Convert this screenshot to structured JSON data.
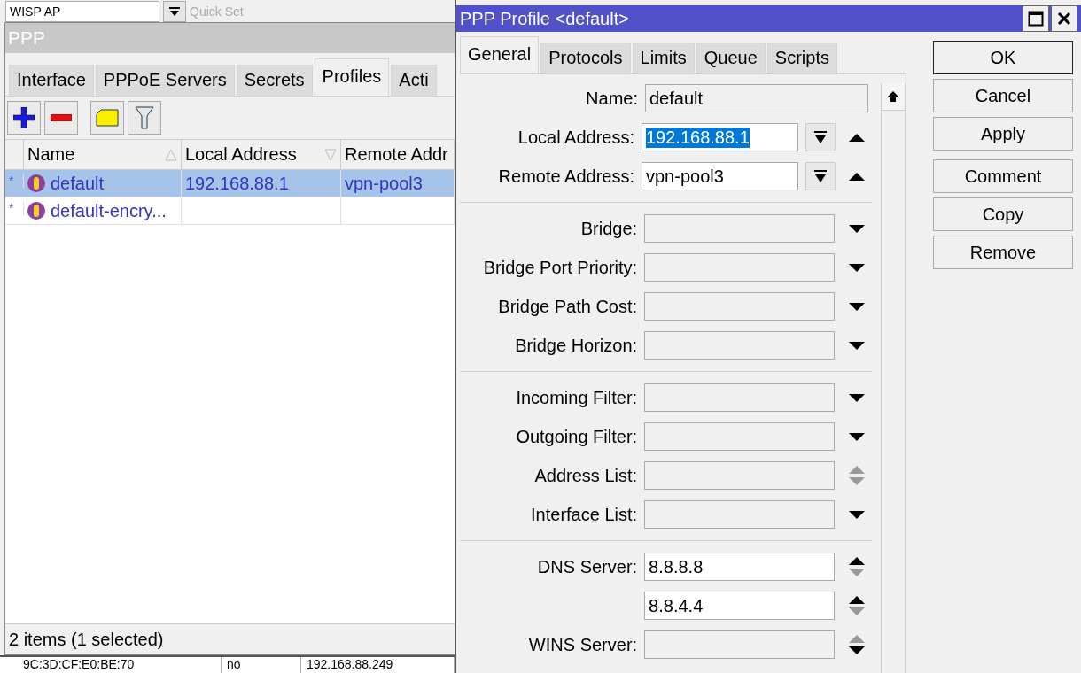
{
  "background": {
    "field_value": "WISP AP",
    "button_label": "Quick Set",
    "row": [
      "9C:3D:CF:E0:BE:70",
      "no",
      "192.168.88.249"
    ]
  },
  "ppp_window": {
    "title": "PPP",
    "tabs": [
      {
        "label": "Interface",
        "selected": false
      },
      {
        "label": "PPPoE Servers",
        "selected": false
      },
      {
        "label": "Secrets",
        "selected": false
      },
      {
        "label": "Profiles",
        "selected": true
      },
      {
        "label": "Acti",
        "selected": false
      }
    ],
    "toolbar": [
      {
        "kind": "add"
      },
      {
        "kind": "remove"
      },
      {
        "kind": "comment"
      },
      {
        "kind": "filter"
      }
    ],
    "table": {
      "columns": [
        {
          "label": "Name",
          "sort_ascending": true
        },
        {
          "label": "Local Address",
          "sort_ascending": false
        },
        {
          "label": "Remote Addr"
        }
      ],
      "rows": [
        {
          "marker": "*",
          "name": "default",
          "local_address": "192.168.88.1",
          "remote_address": "vpn-pool3",
          "selected": true
        },
        {
          "marker": "*",
          "name": "default-encry...",
          "selected": false
        }
      ]
    },
    "status_bar": "2 items (1 selected)"
  },
  "dialog": {
    "title": "PPP Profile <default>",
    "tabs": [
      {
        "label": "General",
        "selected": true
      },
      {
        "label": "Protocols",
        "selected": false
      },
      {
        "label": "Limits",
        "selected": false
      },
      {
        "label": "Queue",
        "selected": false
      },
      {
        "label": "Scripts",
        "selected": false
      }
    ],
    "sections": [
      [
        {
          "kind": "text",
          "label": "Name:",
          "value": "default",
          "editable": false
        },
        {
          "kind": "combo",
          "label": "Local Address:",
          "value": "192.168.88.1",
          "editable": true,
          "highlighted": true
        },
        {
          "kind": "combo",
          "label": "Remote Address:",
          "value": "vpn-pool3",
          "editable": true,
          "highlighted": false
        }
      ],
      [
        {
          "kind": "dropdown",
          "label": "Bridge:",
          "editable": false
        },
        {
          "kind": "dropdown",
          "label": "Bridge Port Priority:",
          "editable": false
        },
        {
          "kind": "dropdown",
          "label": "Bridge Path Cost:",
          "editable": false
        },
        {
          "kind": "dropdown",
          "label": "Bridge Horizon:",
          "editable": false
        }
      ],
      [
        {
          "kind": "dropdown",
          "label": "Incoming Filter:",
          "editable": false
        },
        {
          "kind": "dropdown",
          "label": "Outgoing Filter:",
          "editable": false
        },
        {
          "kind": "list",
          "label": "Address List:",
          "editable": false,
          "up_active": false,
          "down_active": false
        },
        {
          "kind": "dropdown",
          "label": "Interface List:",
          "editable": false
        }
      ],
      [
        {
          "kind": "list",
          "label": "DNS Server:",
          "value": "8.8.8.8",
          "editable": true,
          "up_active": true,
          "down_active": false
        },
        {
          "kind": "list",
          "value": "8.8.4.4",
          "editable": true,
          "up_active": true,
          "down_active": false
        },
        {
          "kind": "list",
          "label": "WINS Server:",
          "editable": false,
          "up_active": false,
          "down_active": true
        }
      ]
    ],
    "buttons": [
      [
        {
          "label": "OK",
          "default": true
        },
        {
          "label": "Cancel",
          "default": false
        },
        {
          "label": "Apply",
          "default": false
        }
      ],
      [
        {
          "label": "Comment",
          "default": false
        },
        {
          "label": "Copy",
          "default": false
        },
        {
          "label": "Remove",
          "default": false
        }
      ]
    ]
  }
}
